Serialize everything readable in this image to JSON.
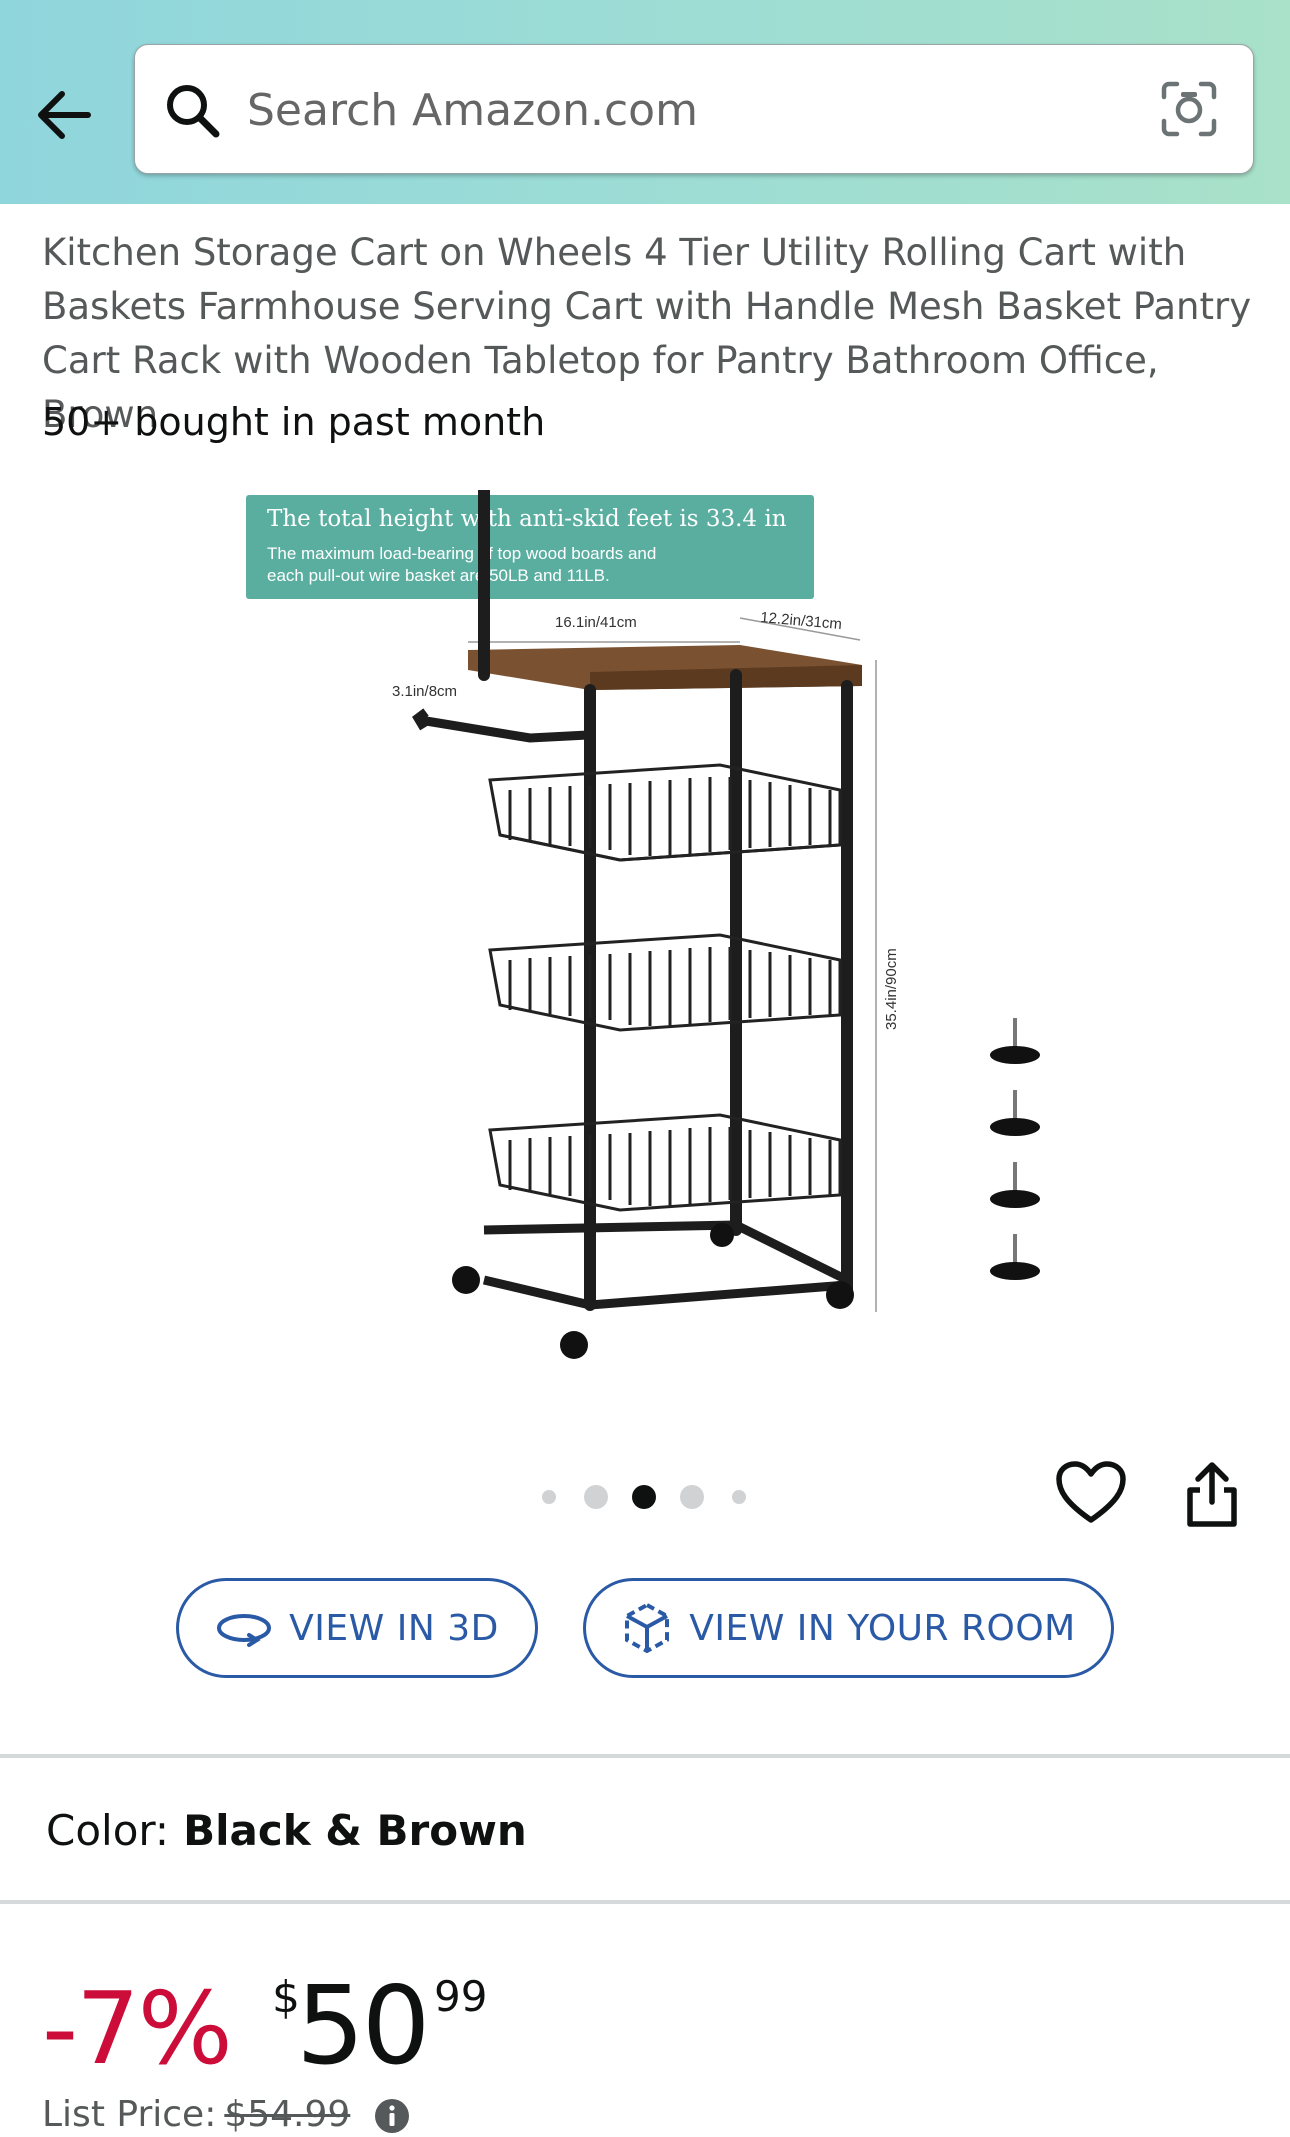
{
  "header": {
    "search_placeholder": "Search Amazon.com"
  },
  "product": {
    "title": "Kitchen Storage Cart on Wheels 4 Tier Utility Rolling Cart with Baskets Farmhouse Serving Cart with Handle Mesh Basket Pantry Cart Rack with Wooden Tabletop for Pantry Bathroom Office, Brown",
    "bought_text": "50+ bought in past month"
  },
  "image": {
    "banner_title": "The total height with anti-skid feet is 33.4 in",
    "banner_line1": "The maximum load-bearing of top wood boards and",
    "banner_line2": "each pull-out wire basket are 50LB and 11LB.",
    "dim_width": "16.1in/41cm",
    "dim_depth": "12.2in/31cm",
    "dim_handle": "3.1in/8cm",
    "dim_height": "35.4in/90cm"
  },
  "carousel": {
    "count": 5,
    "active_index": 2
  },
  "actions": {
    "view_3d_label": "VIEW IN 3D",
    "view_room_label": "VIEW IN YOUR ROOM"
  },
  "variation": {
    "color_label": "Color:",
    "color_value": "Black & Brown"
  },
  "price": {
    "discount": "-7%",
    "currency": "$",
    "whole": "50",
    "fraction": "99",
    "list_label": "List Price:",
    "list_value": "$54.99"
  },
  "colors": {
    "header_start": "#8fd5dc",
    "header_end": "#a9e1c9",
    "discount_red": "#cc0c39",
    "link_blue": "#2a5aa6",
    "banner_teal": "#5aaea0"
  }
}
